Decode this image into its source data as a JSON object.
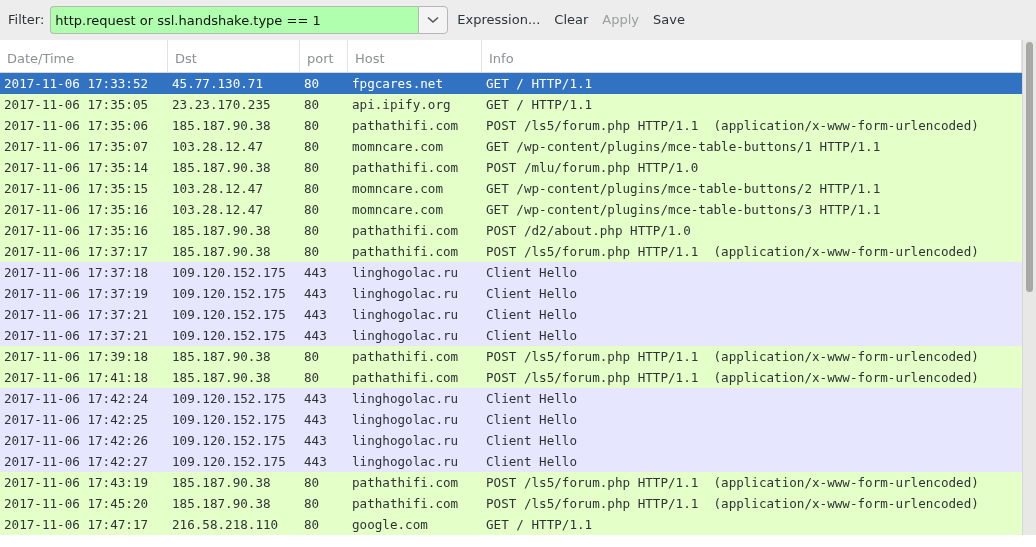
{
  "filter_bar": {
    "label": "Filter:",
    "value": "http.request or ssl.handshake.type == 1",
    "buttons": [
      {
        "label": "Expression...",
        "disabled": false
      },
      {
        "label": "Clear",
        "disabled": false
      },
      {
        "label": "Apply",
        "disabled": true
      },
      {
        "label": "Save",
        "disabled": false
      }
    ]
  },
  "table": {
    "columns": [
      "Date/Time",
      "Dst",
      "port",
      "Host",
      "Info"
    ],
    "rows": [
      {
        "cells": [
          "2017-11-06 17:33:52",
          "45.77.130.71",
          "80",
          "fpgcares.net",
          "GET / HTTP/1.1"
        ],
        "selected": true
      },
      {
        "cells": [
          "2017-11-06 17:35:05",
          "23.23.170.235",
          "80",
          "api.ipify.org",
          "GET / HTTP/1.1"
        ],
        "color": "#e4ffc7",
        "selected": false
      },
      {
        "cells": [
          "2017-11-06 17:35:06",
          "185.187.90.38",
          "80",
          "pathathifi.com",
          "POST /ls5/forum.php HTTP/1.1  (application/x-www-form-urlencoded)"
        ],
        "color": "#e4ffc7",
        "selected": false
      },
      {
        "cells": [
          "2017-11-06 17:35:07",
          "103.28.12.47",
          "80",
          "momncare.com",
          "GET /wp-content/plugins/mce-table-buttons/1 HTTP/1.1"
        ],
        "color": "#e4ffc7",
        "selected": false
      },
      {
        "cells": [
          "2017-11-06 17:35:14",
          "185.187.90.38",
          "80",
          "pathathifi.com",
          "POST /mlu/forum.php HTTP/1.0"
        ],
        "color": "#e4ffc7",
        "selected": false
      },
      {
        "cells": [
          "2017-11-06 17:35:15",
          "103.28.12.47",
          "80",
          "momncare.com",
          "GET /wp-content/plugins/mce-table-buttons/2 HTTP/1.1"
        ],
        "color": "#e4ffc7",
        "selected": false
      },
      {
        "cells": [
          "2017-11-06 17:35:16",
          "103.28.12.47",
          "80",
          "momncare.com",
          "GET /wp-content/plugins/mce-table-buttons/3 HTTP/1.1"
        ],
        "color": "#e4ffc7",
        "selected": false
      },
      {
        "cells": [
          "2017-11-06 17:35:16",
          "185.187.90.38",
          "80",
          "pathathifi.com",
          "POST /d2/about.php HTTP/1.0"
        ],
        "color": "#e4ffc7",
        "selected": false
      },
      {
        "cells": [
          "2017-11-06 17:37:17",
          "185.187.90.38",
          "80",
          "pathathifi.com",
          "POST /ls5/forum.php HTTP/1.1  (application/x-www-form-urlencoded)"
        ],
        "color": "#e4ffc7",
        "selected": false
      },
      {
        "cells": [
          "2017-11-06 17:37:18",
          "109.120.152.175",
          "443",
          "linghogolac.ru",
          "Client Hello"
        ],
        "color": "#e7e6ff",
        "selected": false
      },
      {
        "cells": [
          "2017-11-06 17:37:19",
          "109.120.152.175",
          "443",
          "linghogolac.ru",
          "Client Hello"
        ],
        "color": "#e7e6ff",
        "selected": false
      },
      {
        "cells": [
          "2017-11-06 17:37:21",
          "109.120.152.175",
          "443",
          "linghogolac.ru",
          "Client Hello"
        ],
        "color": "#e7e6ff",
        "selected": false
      },
      {
        "cells": [
          "2017-11-06 17:37:21",
          "109.120.152.175",
          "443",
          "linghogolac.ru",
          "Client Hello"
        ],
        "color": "#e7e6ff",
        "selected": false
      },
      {
        "cells": [
          "2017-11-06 17:39:18",
          "185.187.90.38",
          "80",
          "pathathifi.com",
          "POST /ls5/forum.php HTTP/1.1  (application/x-www-form-urlencoded)"
        ],
        "color": "#e4ffc7",
        "selected": false
      },
      {
        "cells": [
          "2017-11-06 17:41:18",
          "185.187.90.38",
          "80",
          "pathathifi.com",
          "POST /ls5/forum.php HTTP/1.1  (application/x-www-form-urlencoded)"
        ],
        "color": "#e4ffc7",
        "selected": false
      },
      {
        "cells": [
          "2017-11-06 17:42:24",
          "109.120.152.175",
          "443",
          "linghogolac.ru",
          "Client Hello"
        ],
        "color": "#e7e6ff",
        "selected": false
      },
      {
        "cells": [
          "2017-11-06 17:42:25",
          "109.120.152.175",
          "443",
          "linghogolac.ru",
          "Client Hello"
        ],
        "color": "#e7e6ff",
        "selected": false
      },
      {
        "cells": [
          "2017-11-06 17:42:26",
          "109.120.152.175",
          "443",
          "linghogolac.ru",
          "Client Hello"
        ],
        "color": "#e7e6ff",
        "selected": false
      },
      {
        "cells": [
          "2017-11-06 17:42:27",
          "109.120.152.175",
          "443",
          "linghogolac.ru",
          "Client Hello"
        ],
        "color": "#e7e6ff",
        "selected": false
      },
      {
        "cells": [
          "2017-11-06 17:43:19",
          "185.187.90.38",
          "80",
          "pathathifi.com",
          "POST /ls5/forum.php HTTP/1.1  (application/x-www-form-urlencoded)"
        ],
        "color": "#e4ffc7",
        "selected": false
      },
      {
        "cells": [
          "2017-11-06 17:45:20",
          "185.187.90.38",
          "80",
          "pathathifi.com",
          "POST /ls5/forum.php HTTP/1.1  (application/x-www-form-urlencoded)"
        ],
        "color": "#e4ffc7",
        "selected": false
      },
      {
        "cells": [
          "2017-11-06 17:47:17",
          "216.58.218.110",
          "80",
          "google.com",
          "GET / HTTP/1.1"
        ],
        "color": "#e4ffc7",
        "selected": false
      }
    ]
  }
}
